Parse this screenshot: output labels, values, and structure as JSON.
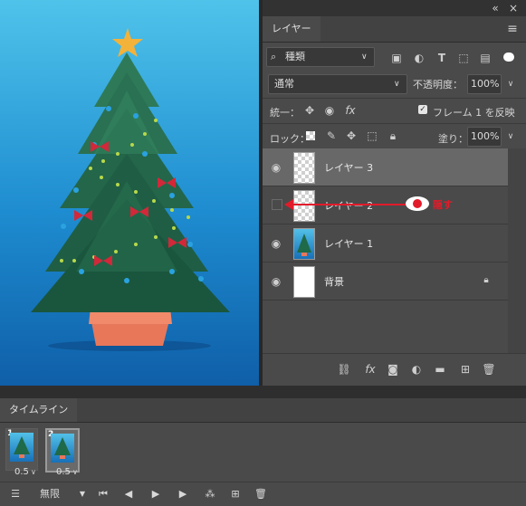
{
  "layers_panel": {
    "tab_label": "レイヤー",
    "filter_kind": "種類",
    "blend_mode": "通常",
    "opacity_label": "不透明度：",
    "opacity_value": "100%",
    "unify_label": "統一：",
    "propagate_label": "フレーム 1 を反映",
    "lock_label": "ロック：",
    "fill_label": "塗り：",
    "fill_value": "100%",
    "layers": [
      {
        "name": "レイヤー 3",
        "visible": true,
        "selected": true
      },
      {
        "name": "レイヤー 2",
        "visible": false,
        "selected": false
      },
      {
        "name": "レイヤー 1",
        "visible": true,
        "selected": false
      },
      {
        "name": "背景",
        "visible": true,
        "selected": false,
        "locked": true
      }
    ]
  },
  "annotation": {
    "label": "隠す",
    "color": "#e21b2a"
  },
  "timeline": {
    "tab_label": "タイムライン",
    "frames": [
      {
        "number": "1",
        "delay": "0.5"
      },
      {
        "number": "2",
        "delay": "0.5",
        "selected": true
      }
    ],
    "loop": "無限"
  },
  "colors": {
    "panel_bg": "#4a4a4a",
    "selected_row": "#686868",
    "accent_red": "#e21b2a"
  }
}
